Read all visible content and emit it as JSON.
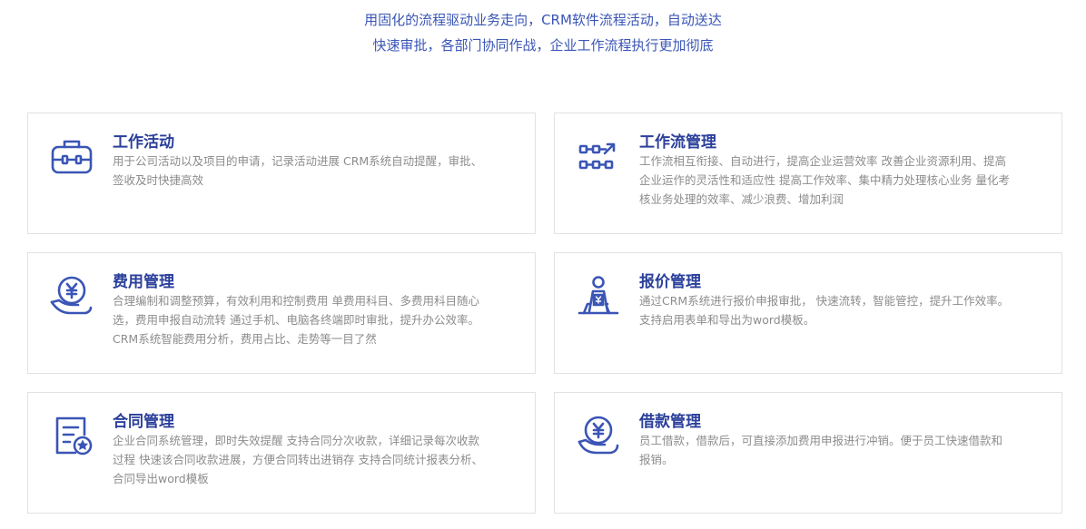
{
  "intro": {
    "line1": "用固化的流程驱动业务走向，CRM软件流程活动，自动送达",
    "line2": "快速审批，各部门协同作战，企业工作流程执行更加彻底"
  },
  "cards": [
    {
      "title": "工作活动",
      "icon": "toolbox-icon",
      "lines": [
        "用于公司活动以及项目的申请，记录活动进展 CRM系统自动提醒，审批、",
        "签收及时快捷高效"
      ]
    },
    {
      "title": "工作流管理",
      "icon": "workflow-icon",
      "lines": [
        "工作流相互衔接、自动进行，提高企业运营效率 改善企业资源利用、提高",
        "企业运作的灵活性和适应性 提高工作效率、集中精力处理核心业务 量化考",
        "核业务处理的效率、减少浪费、增加利润"
      ]
    },
    {
      "title": "费用管理",
      "icon": "hand-coin-icon",
      "lines": [
        "合理编制和调整预算，有效利用和控制费用 单费用科目、多费用科目随心",
        "选，费用申报自动流转 通过手机、电脑各终端即时审批，提升办公效率。",
        "CRM系统智能费用分析，费用占比、走势等一目了然"
      ]
    },
    {
      "title": "报价管理",
      "icon": "quote-person-icon",
      "lines": [
        "通过CRM系统进行报价申报审批， 快速流转，智能管控，提升工作效率。",
        "支持启用表单和导出为word模板。"
      ]
    },
    {
      "title": "合同管理",
      "icon": "contract-icon",
      "lines": [
        "企业合同系统管理，即时失效提醒 支持合同分次收款，详细记录每次收款",
        "过程 快速该合同收款进展，方便合同转出进销存 支持合同统计报表分析、",
        "合同导出word模板"
      ]
    },
    {
      "title": "借款管理",
      "icon": "loan-coin-icon",
      "lines": [
        "员工借款，借款后，可直接添加费用申报进行冲销。便于员工快速借款和",
        "报销。"
      ]
    }
  ],
  "colors": {
    "accent": "#3a55b5",
    "title": "#2a3f9a",
    "text": "#8c8c8c",
    "border": "#e2e2e2"
  }
}
